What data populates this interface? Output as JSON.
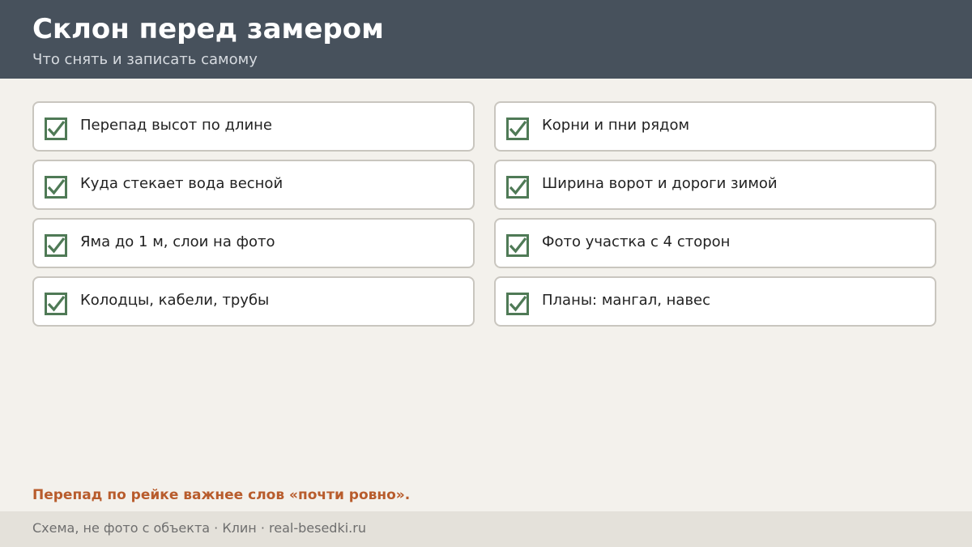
{
  "header": {
    "title": "Склон перед замером",
    "subtitle": "Что снять и записать самому"
  },
  "checklist": {
    "items": [
      {
        "label": "Перепад высот по длине",
        "checked": true
      },
      {
        "label": "Корни и пни рядом",
        "checked": true
      },
      {
        "label": "Куда стекает вода весной",
        "checked": true
      },
      {
        "label": "Ширина ворот и дороги зимой",
        "checked": true
      },
      {
        "label": "Яма до 1 м, слои на фото",
        "checked": true
      },
      {
        "label": "Фото участка с 4 сторон",
        "checked": true
      },
      {
        "label": "Колодцы, кабели, трубы",
        "checked": true
      },
      {
        "label": "Планы: мангал, навес",
        "checked": true
      }
    ],
    "check_icon": "checkbox-checked-icon",
    "check_color": "#4f7a56"
  },
  "note": "Перепад по рейке важнее слов «почти ровно».",
  "footer": {
    "text": "Схема, не фото с объекта  ·  Клин  ·  real-besedki.ru"
  },
  "colors": {
    "header_bg": "#47515c",
    "page_bg": "#f3f1ec",
    "accent": "#b85c2c",
    "footer_bg": "#e4e1da"
  }
}
